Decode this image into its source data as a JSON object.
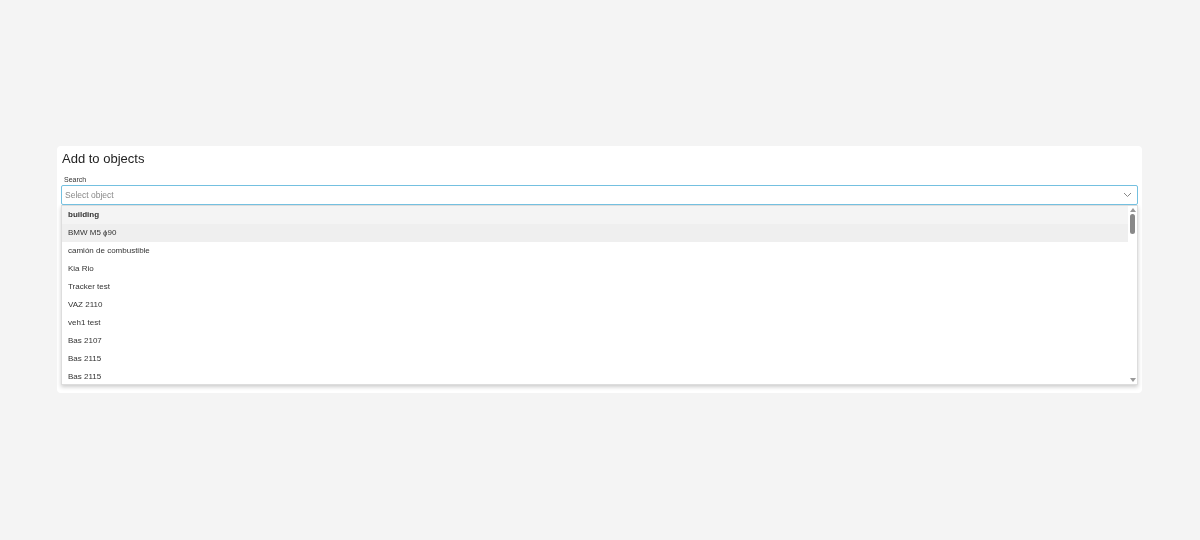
{
  "title": "Add to objects",
  "search": {
    "label": "Search",
    "placeholder": "Select object"
  },
  "options": [
    {
      "kind": "group",
      "text": "building"
    },
    {
      "kind": "option",
      "text": "BMW M5 ɸ90",
      "selected": true
    },
    {
      "kind": "option",
      "text": "camión de combustible",
      "selected": false
    },
    {
      "kind": "option",
      "text": "Kia Rio",
      "selected": false
    },
    {
      "kind": "option",
      "text": "Tracker test",
      "selected": false
    },
    {
      "kind": "option",
      "text": "VAZ 2110",
      "selected": false
    },
    {
      "kind": "option",
      "text": "veh1 test",
      "selected": false
    },
    {
      "kind": "option",
      "text": "Bas 2107",
      "selected": false
    },
    {
      "kind": "option",
      "text": "Bas 2115",
      "selected": false
    },
    {
      "kind": "option",
      "text": "Bas 2115",
      "selected": false
    }
  ]
}
